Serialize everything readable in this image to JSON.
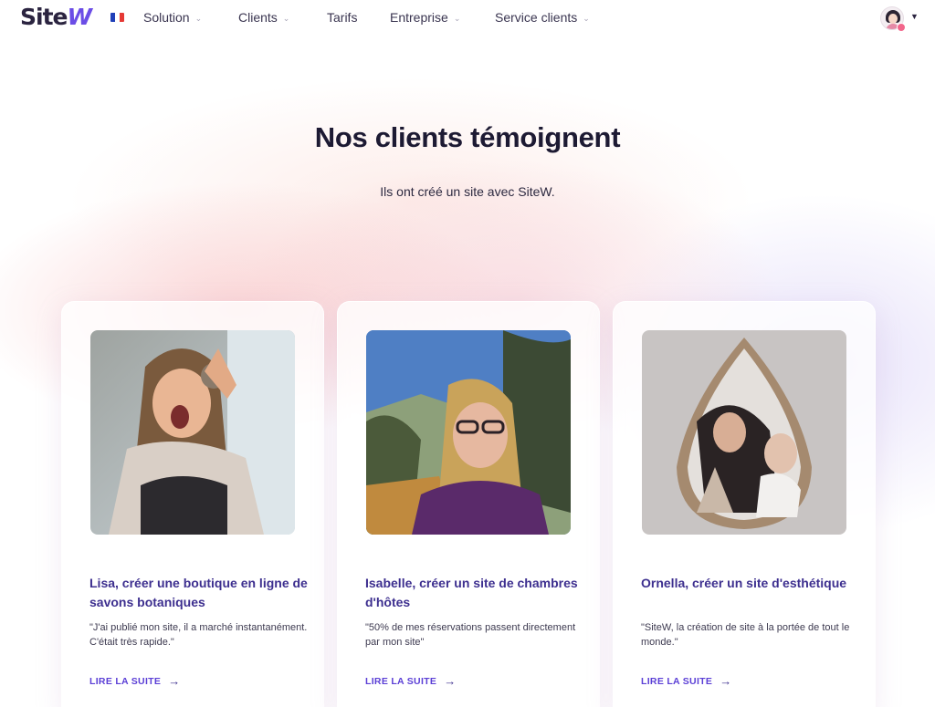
{
  "header": {
    "logo_text": "Site",
    "logo_accent": "W",
    "flag_colors": [
      "#1f3fb8",
      "#ffffff",
      "#e53935"
    ],
    "nav": [
      {
        "label": "Solution",
        "has_dropdown": true
      },
      {
        "label": "Clients",
        "has_dropdown": true
      },
      {
        "label": "Tarifs",
        "has_dropdown": false
      },
      {
        "label": "Entreprise",
        "has_dropdown": true
      },
      {
        "label": "Service clients",
        "has_dropdown": true
      }
    ],
    "account_icon": "user-avatar-icon"
  },
  "hero": {
    "title": "Nos clients témoignent",
    "subtitle": "Ils ont créé un site avec SiteW."
  },
  "cards": [
    {
      "title": "Lisa, créer une boutique en ligne de savons botaniques",
      "quote": "\"J'ai publié mon site, il a marché instantanément. C'était très rapide.\"",
      "link": "LIRE LA SUITE",
      "image": "photo-woman-holding-soap"
    },
    {
      "title": "Isabelle, créer un site de chambres d'hôtes",
      "quote": "\"50% de mes réservations passent directement par mon site\"",
      "link": "LIRE LA SUITE",
      "image": "photo-woman-outdoors-glasses"
    },
    {
      "title": "Ornella, créer un site d'esthétique",
      "quote": "\"SiteW, la création de site à la portée de tout le monde.\"",
      "link": "LIRE LA SUITE",
      "image": "photo-makeup-artist-mirror"
    }
  ],
  "colors": {
    "accent": "#5b3fd6",
    "card_title": "#3d2f8f",
    "heading": "#1d1a33"
  }
}
